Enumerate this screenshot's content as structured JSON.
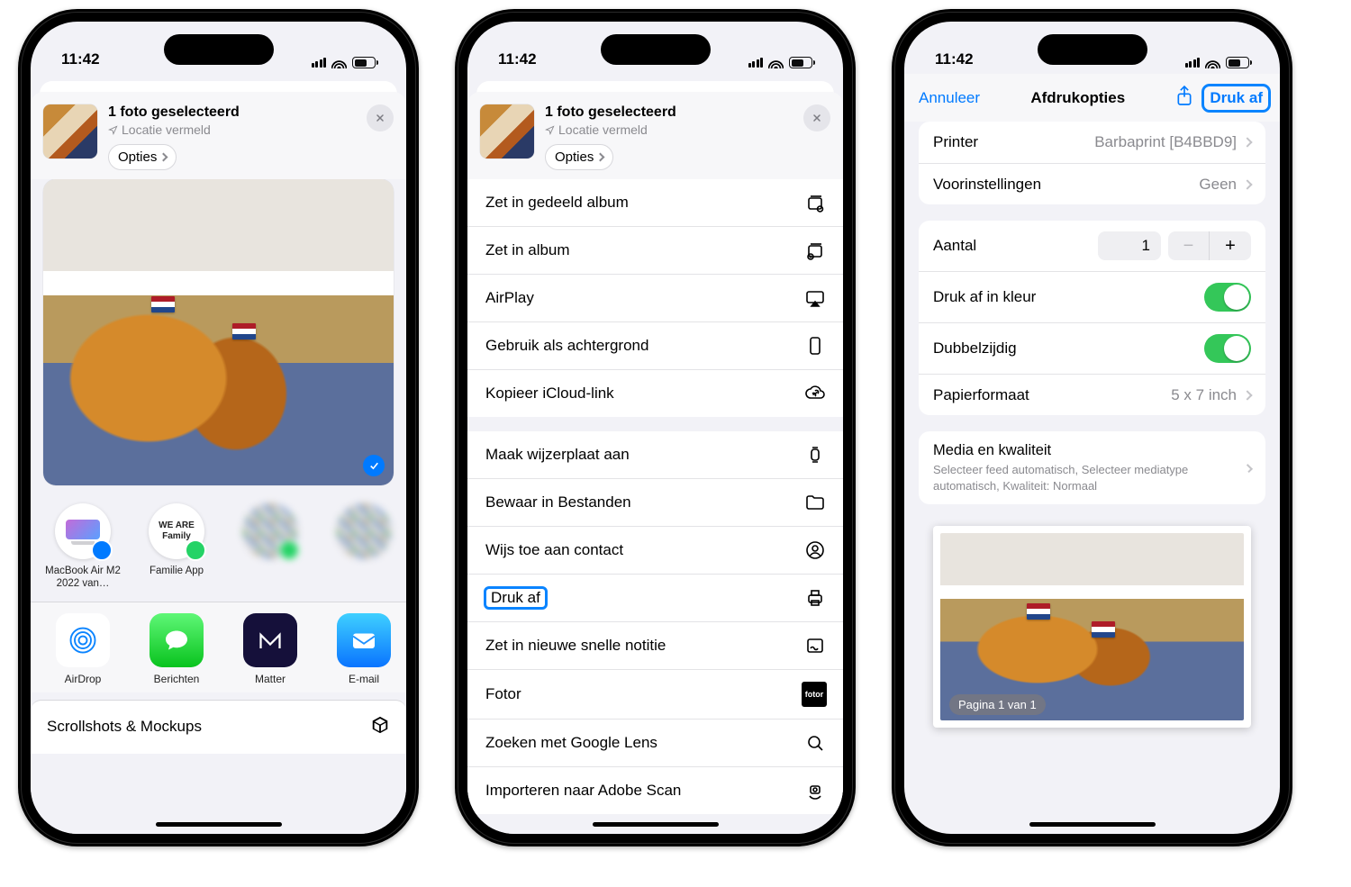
{
  "status_time": "11:42",
  "share_header": {
    "title": "1 foto geselecteerd",
    "location": "Locatie vermeld",
    "options_chip": "Opties"
  },
  "phone1": {
    "targets": [
      {
        "label": "MacBook Air M2 2022 van…"
      },
      {
        "label": "Familie App"
      },
      {
        "label": ""
      },
      {
        "label": ""
      }
    ],
    "apps": [
      {
        "label": "AirDrop"
      },
      {
        "label": "Berichten"
      },
      {
        "label": "Matter"
      },
      {
        "label": "E-mail"
      }
    ],
    "extra_row": "Scrollshots & Mockups"
  },
  "phone2": {
    "group1": [
      {
        "label": "Zet in gedeeld album",
        "icon": "shared-album-icon"
      },
      {
        "label": "Zet in album",
        "icon": "album-add-icon"
      },
      {
        "label": "AirPlay",
        "icon": "airplay-icon"
      },
      {
        "label": "Gebruik als achtergrond",
        "icon": "wallpaper-icon"
      },
      {
        "label": "Kopieer iCloud-link",
        "icon": "icloud-link-icon"
      }
    ],
    "group2": [
      {
        "label": "Maak wijzerplaat aan",
        "icon": "watch-face-icon"
      },
      {
        "label": "Bewaar in Bestanden",
        "icon": "folder-icon"
      },
      {
        "label": "Wijs toe aan contact",
        "icon": "contact-icon"
      },
      {
        "label": "Druk af",
        "icon": "print-icon",
        "highlight": true
      },
      {
        "label": "Zet in nieuwe snelle notitie",
        "icon": "quick-note-icon"
      },
      {
        "label": "Fotor",
        "icon": "fotor-icon"
      },
      {
        "label": "Zoeken met Google Lens",
        "icon": "search-icon"
      },
      {
        "label": "Importeren naar Adobe Scan",
        "icon": "adobe-scan-icon"
      }
    ]
  },
  "phone3": {
    "nav": {
      "cancel": "Annuleer",
      "title": "Afdrukopties",
      "print": "Druk af"
    },
    "printer": {
      "label": "Printer",
      "value": "Barbaprint [B4BBD9]"
    },
    "presets": {
      "label": "Voorinstellingen",
      "value": "Geen"
    },
    "count": {
      "label": "Aantal",
      "value": "1"
    },
    "color": {
      "label": "Druk af in kleur"
    },
    "duplex": {
      "label": "Dubbelzijdig"
    },
    "paper": {
      "label": "Papierformaat",
      "value": "5 x 7 inch"
    },
    "media": {
      "title": "Media en kwaliteit",
      "subtitle": "Selecteer feed automatisch, Selecteer mediatype automatisch, Kwaliteit: Normaal"
    },
    "page_pill": "Pagina 1 van 1"
  }
}
